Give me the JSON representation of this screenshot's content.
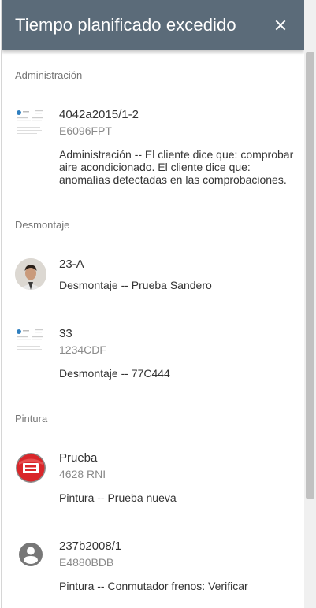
{
  "header": {
    "title": "Tiempo planificado excedido",
    "close_icon": "close-icon"
  },
  "sections": [
    {
      "label": "Administración",
      "items": [
        {
          "code": "4042a2015/1-2",
          "plate": "E6096FPT",
          "description": "Administración -- El cliente dice que: comprobar aire acondicionado. El cliente dice que: anomalías detectadas en las comprobaciones.",
          "thumbnail": "document-thumbnail"
        }
      ]
    },
    {
      "label": "Desmontaje",
      "items": [
        {
          "code": "23-A",
          "plate": "",
          "description": "Desmontaje -- Prueba Sandero",
          "thumbnail": "person-photo"
        },
        {
          "code": "33",
          "plate": "1234CDF",
          "description": "Desmontaje -- 77C444",
          "thumbnail": "document-thumbnail"
        }
      ]
    },
    {
      "label": "Pintura",
      "items": [
        {
          "code": "Prueba",
          "plate": "4628 RNI",
          "description": "Pintura -- Prueba nueva",
          "thumbnail": "brand-logo"
        },
        {
          "code": "237b2008/1",
          "plate": "E4880BDB",
          "description": "Pintura -- Conmutador frenos: Verificar",
          "thumbnail": "account-circle-icon"
        }
      ]
    }
  ],
  "colors": {
    "header_bg": "#5b6b79",
    "logo_red": "#d9262a"
  }
}
